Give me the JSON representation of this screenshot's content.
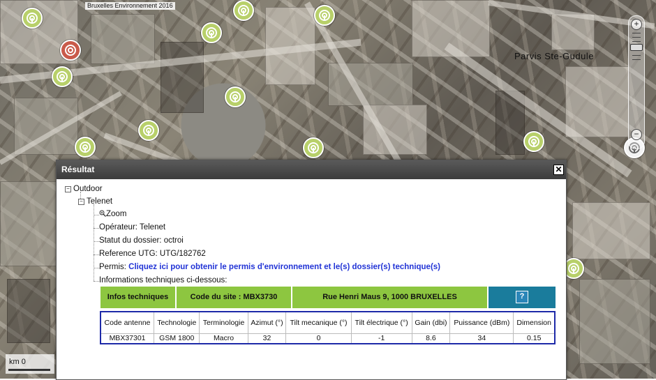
{
  "map": {
    "copyright": "Bruxelles Environnement 2016",
    "place_label": "Parvis Ste-Gudule",
    "scale_label": "km 0",
    "zoom_in": "+",
    "zoom_out": "−"
  },
  "dialog": {
    "title": "Résultat",
    "close": "✕",
    "tree": {
      "root": "Outdoor",
      "operator_node": "Telenet",
      "zoom": "Zoom",
      "operateur_label": "Opérateur: ",
      "operateur_value": "Telenet",
      "statut_label": "Statut du dossier: ",
      "statut_value": "octroi",
      "reference_label": "Reference UTG: ",
      "reference_value": "UTG/182762",
      "permis_label": "Permis: ",
      "permis_link": "Cliquez ici pour obtenir le permis d'environnement et le(s) dossier(s) technique(s)",
      "info_label": "Informations techniques ci-dessous:"
    },
    "info_bar": {
      "infos": "Infos techniques",
      "code_site": "Code du site : MBX3730",
      "address": "Rue Henri Maus 9, 1000 BRUXELLES",
      "help": "?"
    },
    "table": {
      "headers": [
        "Code antenne",
        "Technologie",
        "Terminologie",
        "Azimut (°)",
        "Tilt mecanique (°)",
        "Tilt électrique (°)",
        "Gain (dbi)",
        "Puissance (dBm)",
        "Dimension"
      ],
      "rows": [
        [
          "MBX37301",
          "GSM 1800",
          "Macro",
          "32",
          "0",
          "-1",
          "8.6",
          "34",
          "0.15"
        ]
      ]
    }
  }
}
